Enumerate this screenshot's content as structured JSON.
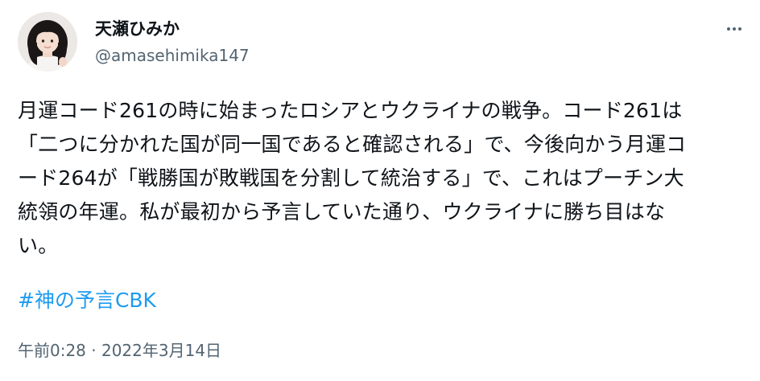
{
  "author": {
    "display_name": "天瀬ひみか",
    "handle": "@amasehimika147",
    "avatar_icon": "profile-photo"
  },
  "menu": {
    "icon": "more-horizontal-icon"
  },
  "tweet": {
    "text": "月運コード261の時に始まったロシアとウクライナの戦争。コード261は\n「二つに分かれた国が同一国であると確認される」で、今後向かう月運コ\nード264が「戦勝国が敗戦国を分割して統治する」で、これはプーチン大\n統領の年運。私が最初から予言していた通り、ウクライナに勝ち目はな\nい。",
    "hashtag": "#神の予言CBK",
    "timestamp": "午前0:28 · 2022年3月14日"
  },
  "colors": {
    "link": "#1d9bf0",
    "secondary_text": "#536471",
    "primary_text": "#0f1419"
  }
}
